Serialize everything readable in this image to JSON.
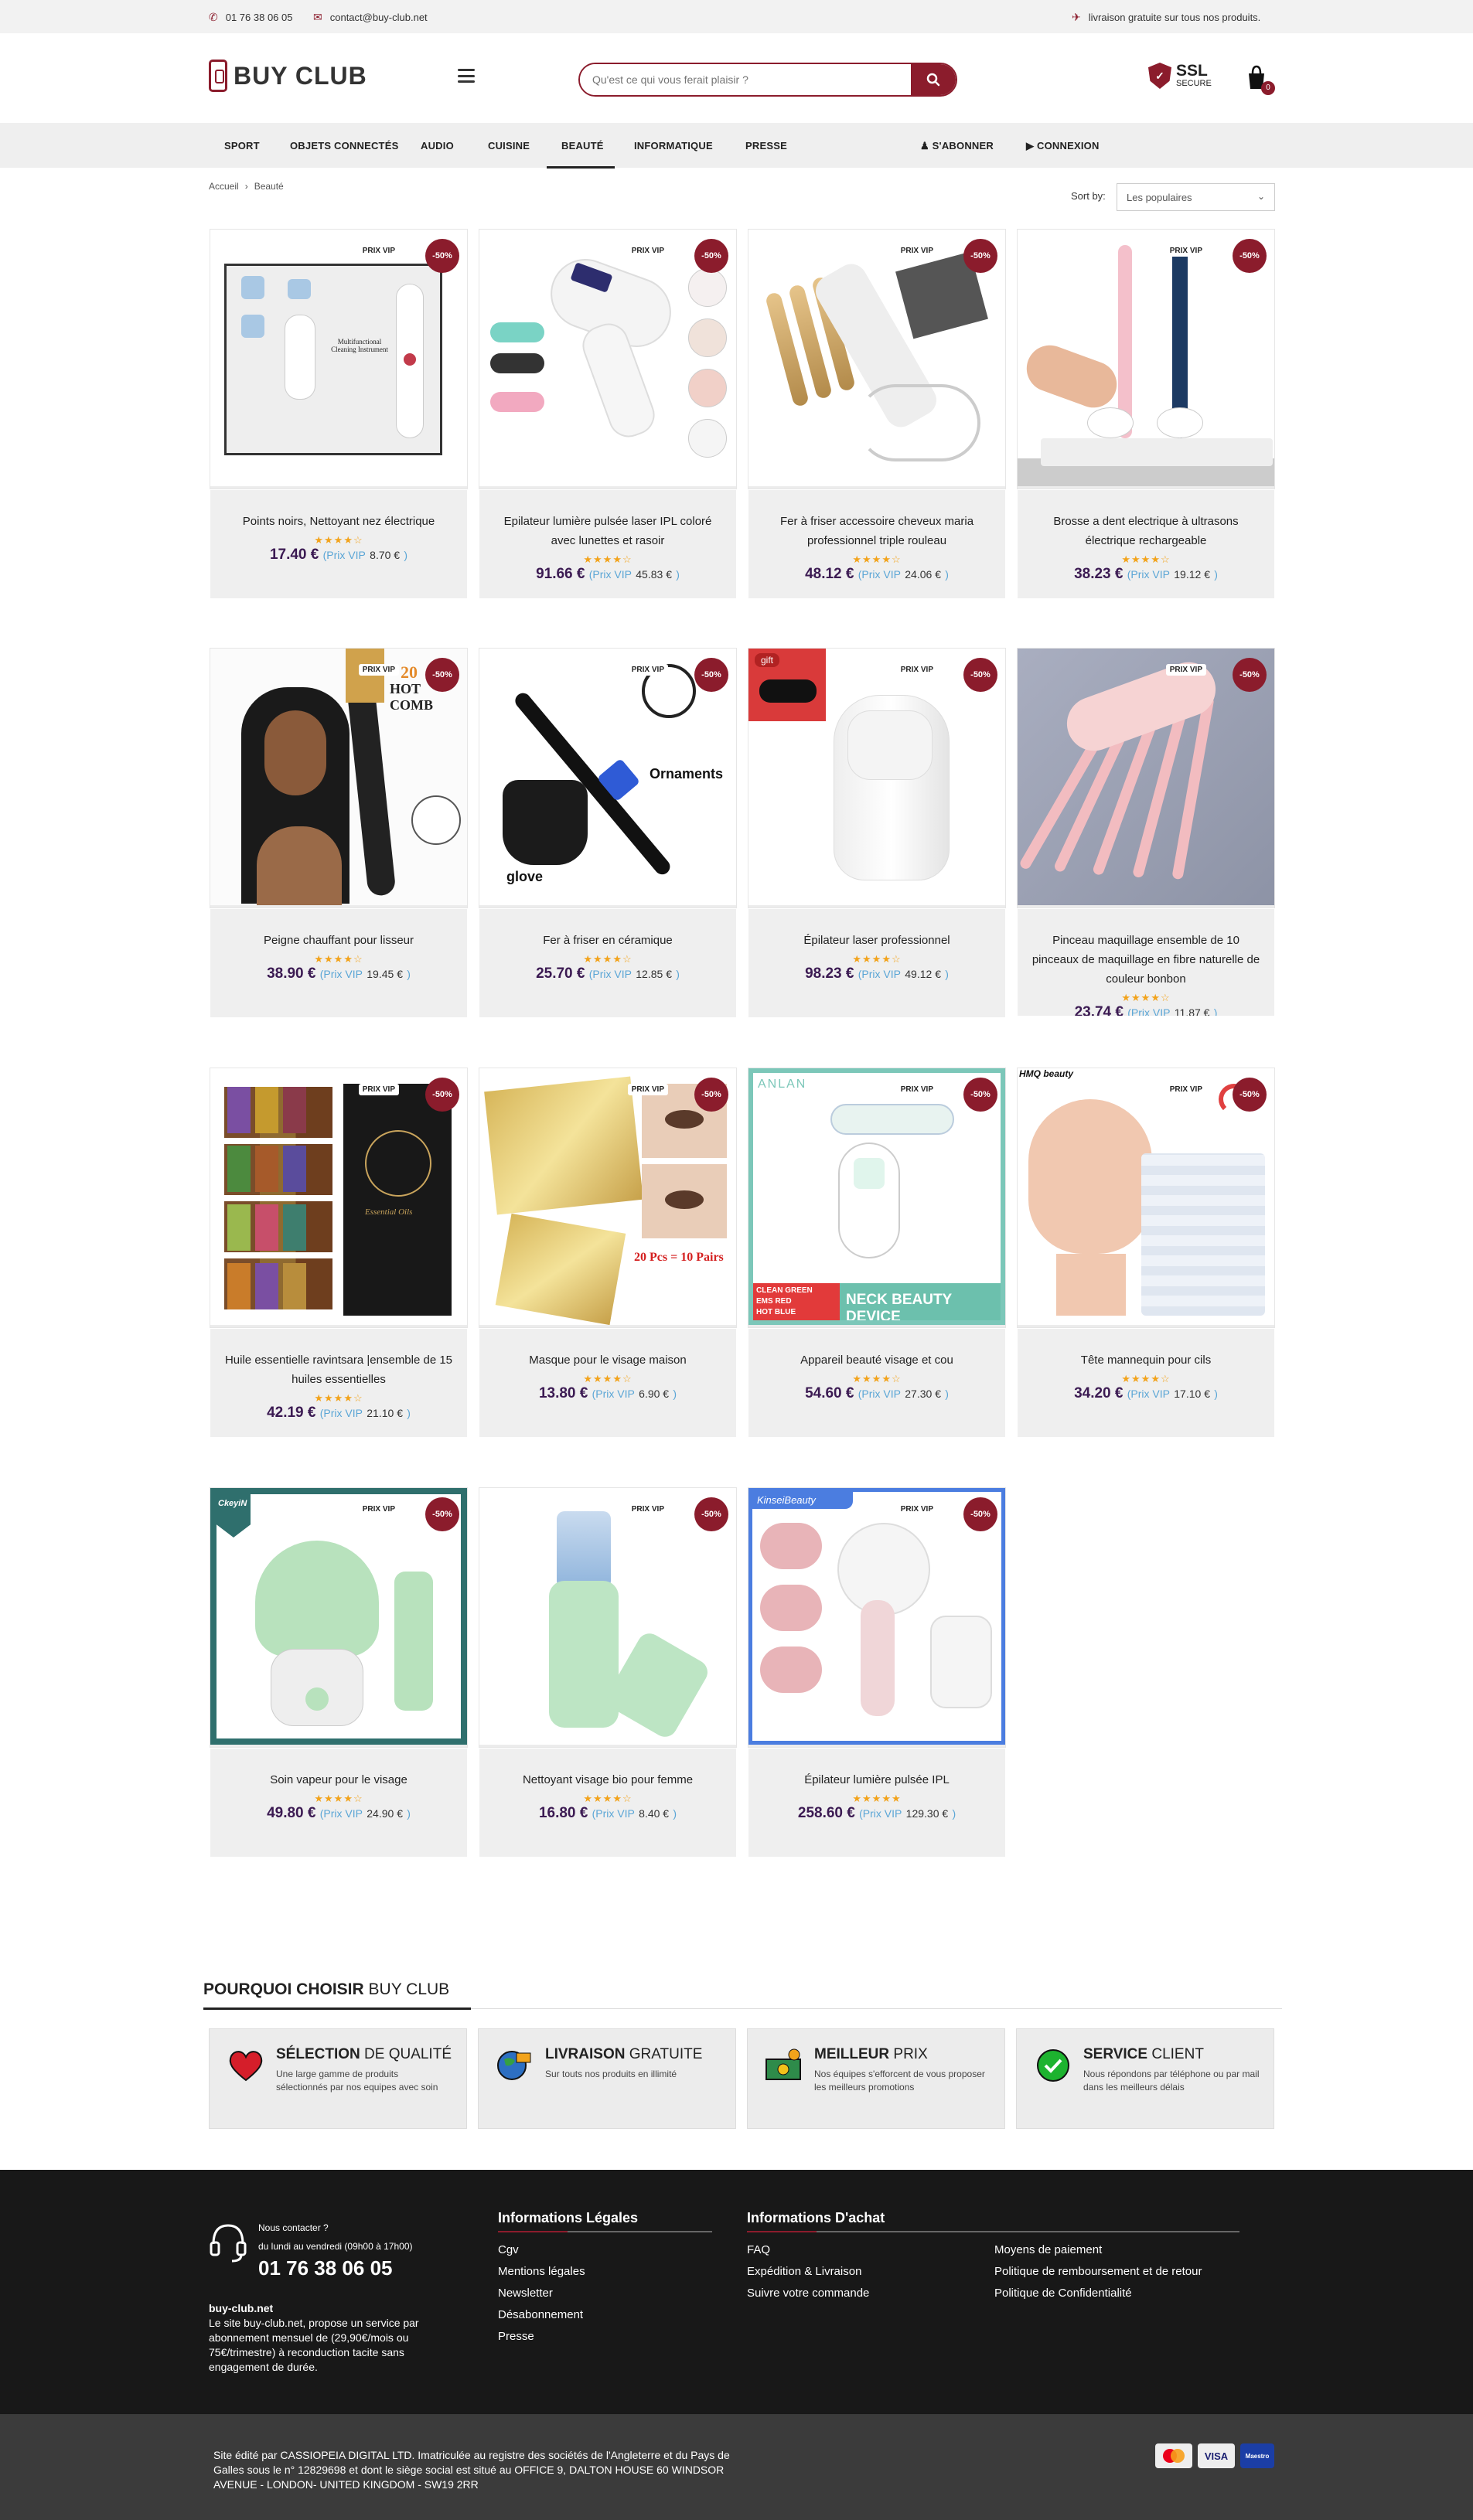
{
  "topbar": {
    "phone": "01 76 38 06 05",
    "email": "contact@buy-club.net",
    "shipping": "livraison gratuite sur tous nos produits."
  },
  "header": {
    "logo_text": "BUY CLUB",
    "search_placeholder": "Qu'est ce qui vous ferait plaisir ?",
    "ssl_title": "SSL",
    "ssl_sub": "SECURE",
    "cart_count": "0"
  },
  "nav": {
    "items": [
      "SPORT",
      "OBJETS CONNECTÉS",
      "AUDIO",
      "CUISINE",
      "BEAUTÉ",
      "INFORMATIQUE",
      "PRESSE"
    ],
    "active": "BEAUTÉ",
    "subscribe": "S'ABONNER",
    "login": "CONNEXION"
  },
  "breadcrumb": {
    "home": "Accueil",
    "sep": "›",
    "current": "Beauté"
  },
  "sort": {
    "label": "Sort by:",
    "selected": "Les populaires"
  },
  "product_labels": {
    "vip": "PRIX VIP",
    "discount": "-50%",
    "vip_price_prefix": "(Prix VIP",
    "vip_price_suffix": ")"
  },
  "products": [
    {
      "name": "Points noirs, Nettoyant nez électrique",
      "stars": "★★★★☆",
      "price": "17.40 €",
      "vip": "8.70 €"
    },
    {
      "name": "Epilateur lumière pulsée laser IPL coloré avec lunettes et rasoir",
      "stars": "★★★★☆",
      "price": "91.66 €",
      "vip": "45.83 €"
    },
    {
      "name": "Fer à friser accessoire cheveux maria professionnel triple rouleau",
      "stars": "★★★★☆",
      "price": "48.12 €",
      "vip": "24.06 €"
    },
    {
      "name": "Brosse a dent electrique à ultrasons électrique rechargeable",
      "stars": "★★★★☆",
      "price": "38.23 €",
      "vip": "19.12 €"
    },
    {
      "name": "Peigne chauffant pour lisseur",
      "stars": "★★★★☆",
      "price": "38.90 €",
      "vip": "19.45 €"
    },
    {
      "name": "Fer à friser en céramique",
      "stars": "★★★★☆",
      "price": "25.70 €",
      "vip": "12.85 €"
    },
    {
      "name": "Épilateur laser professionnel",
      "stars": "★★★★☆",
      "price": "98.23 €",
      "vip": "49.12 €"
    },
    {
      "name": "Pinceau maquillage ensemble de 10 pinceaux de maquillage en fibre naturelle de couleur bonbon",
      "stars": "★★★★☆",
      "price": "23.74 €",
      "vip": "11.87 €"
    },
    {
      "name": "Huile essentielle ravintsara |ensemble de 15 huiles essentielles",
      "stars": "★★★★☆",
      "price": "42.19 €",
      "vip": "21.10 €"
    },
    {
      "name": "Masque pour le visage maison",
      "stars": "★★★★☆",
      "price": "13.80 €",
      "vip": "6.90 €"
    },
    {
      "name": "Appareil beauté visage et cou",
      "stars": "★★★★☆",
      "price": "54.60 €",
      "vip": "27.30 €"
    },
    {
      "name": "Tête mannequin pour cils",
      "stars": "★★★★☆",
      "price": "34.20 €",
      "vip": "17.10 €"
    },
    {
      "name": "Soin vapeur pour le visage",
      "stars": "★★★★☆",
      "price": "49.80 €",
      "vip": "24.90 €"
    },
    {
      "name": "Nettoyant visage bio pour femme",
      "stars": "★★★★☆",
      "price": "16.80 €",
      "vip": "8.40 €"
    },
    {
      "name": "Épilateur lumière pulsée IPL",
      "stars": "★★★★★",
      "price": "258.60 €",
      "vip": "129.30 €"
    }
  ],
  "image_text": {
    "p1": "Multifunctional Cleaning Instrument",
    "p5": "HOT COMB",
    "p5b": "20",
    "p6a": "Ornaments",
    "p6b": "glove",
    "p7": "gift",
    "p10": "20 Pcs = 10 Pairs",
    "p11a": "ANLAN",
    "p11b": "NECK BEAUTY DEVICE",
    "p11c": "CLEAN  GREEN",
    "p11d": "EMS     RED",
    "p11e": "HOT      BLUE",
    "p12": "HMQ beauty",
    "p13": "CkeyiN",
    "p15": "KinseiBeauty",
    "p9": "Essential Oils"
  },
  "why": {
    "title_bold": "POURQUOI CHOISIR",
    "title_rest": "BUY CLUB",
    "items": [
      {
        "bold": "SÉLECTION",
        "rest": "DE QUALITÉ",
        "desc": "Une large gamme de produits sélectionnés par nos equipes avec soin",
        "icon": "heart-icon"
      },
      {
        "bold": "LIVRAISON",
        "rest": "GRATUITE",
        "desc": "Sur touts nos produits en illimité",
        "icon": "globe-truck-icon"
      },
      {
        "bold": "MEILLEUR",
        "rest": "PRIX",
        "desc": "Nos équipes s'efforcent de vous proposer les meilleurs promotions",
        "icon": "money-icon"
      },
      {
        "bold": "SERVICE",
        "rest": "CLIENT",
        "desc": "Nous répondons par téléphone ou par mail dans les meilleurs délais",
        "icon": "check-icon"
      }
    ]
  },
  "footer": {
    "contact_q": "Nous contacter ?",
    "hours": "du lundi au vendredi (09h00 à 17h00)",
    "phone": "01 76 38 06 05",
    "brand": "buy-club.net",
    "brand_desc": "Le site buy-club.net, propose un service par abonnement mensuel de (29,90€/mois ou 75€/trimestre) à reconduction tacite sans engagement de durée.",
    "legal_title": "Informations Légales",
    "legal_links": [
      "Cgv",
      "Mentions légales",
      "Newsletter",
      "Désabonnement",
      "Presse"
    ],
    "buy_title": "Informations D'achat",
    "buy_links_1": [
      "FAQ",
      "Expédition & Livraison",
      "Suivre votre commande"
    ],
    "buy_links_2": [
      "Moyens de paiement",
      "Politique de remboursement et de retour",
      "Politique de Confidentialité"
    ],
    "legal_text": "Site édité par CASSIOPEIA DIGITAL LTD. Imatriculée au registre des sociétés de l'Angleterre et du Pays de Galles sous le n° 12829698 et dont le siège social est situé au OFFICE 9, DALTON HOUSE 60 WINDSOR AVENUE - LONDON- UNITED KINGDOM - SW19 2RR",
    "pay": [
      "mastercard",
      "VISA",
      "Maestro"
    ]
  },
  "colors": {
    "accent": "#8b1c2c",
    "price": "#3b1a52",
    "vip": "#5ba6d6",
    "star": "#f2a31b"
  }
}
